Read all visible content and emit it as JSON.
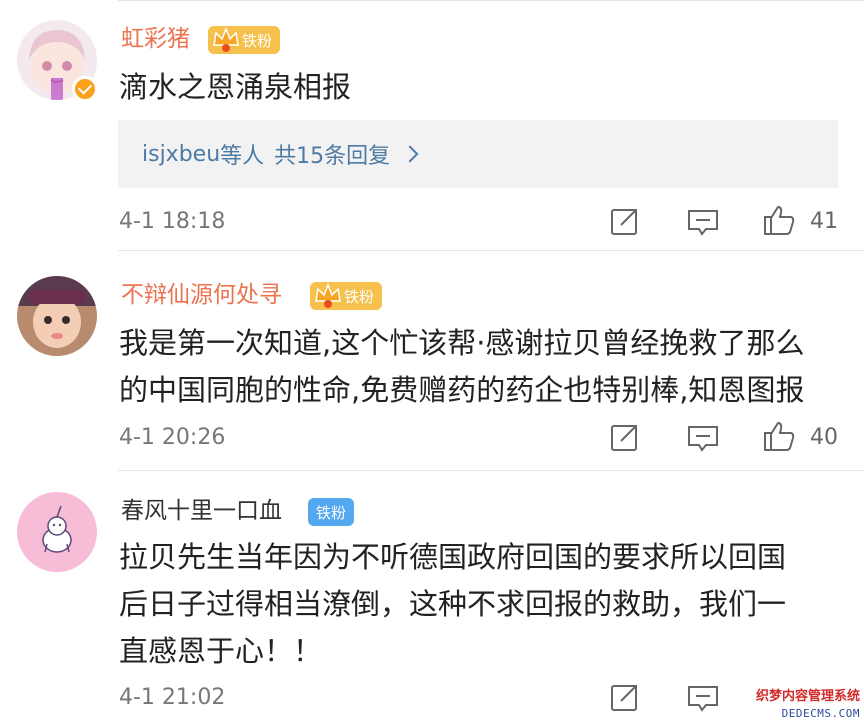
{
  "comments": [
    {
      "username": "虹彩猪",
      "badge": "铁粉",
      "text_lines": [
        "滴水之恩涌泉相报"
      ],
      "reply": {
        "who": "isjxbeu",
        "etc": "等人",
        "count": "共15条回复"
      },
      "time": "4-1 18:18",
      "likes": "41"
    },
    {
      "username": "不辩仙源何处寻",
      "badge": "铁粉",
      "text_lines": [
        "我是第一次知道,这个忙该帮·感谢拉贝曾经挽救了那么",
        "的中国同胞的性命,免费赠药的药企也特别棒,知恩图报"
      ],
      "time": "4-1 20:26",
      "likes": "40"
    },
    {
      "username": "春风十里一口血",
      "badge": "铁粉",
      "text_lines": [
        "拉贝先生当年因为不听德国政府回国的要求所以回国",
        "后日子过得相当潦倒，这种不求回报的救助，我们一",
        "直感恩于心！！"
      ],
      "time": "4-1 21:02",
      "likes": ""
    }
  ],
  "watermark": {
    "line1": "织梦内容管理系统",
    "line2": "DEDECMS.COM"
  },
  "colors": {
    "gold_name": "#eb7350",
    "link_blue": "#4e7aa6",
    "badge_gold": "#f5c04c",
    "badge_blue": "#54a8f0"
  },
  "icons": {
    "share": "share-icon",
    "comment": "comment-icon",
    "like": "thumbs-up-icon"
  }
}
